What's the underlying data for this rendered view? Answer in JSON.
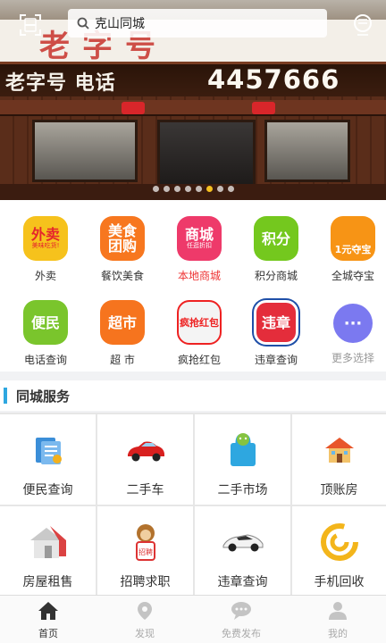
{
  "search": {
    "text": "克山同城"
  },
  "banner": {
    "sign_mark": "老字号",
    "sign_text": "老字号 电话",
    "sign_phone": "4457666",
    "slide_count": 8,
    "active_slide": 5
  },
  "quick_menu": {
    "items": [
      {
        "label": "外卖",
        "icon_text": "外卖",
        "icon_sub": "美味吃货!",
        "icon": "takeout-icon",
        "color": "#f6c21c",
        "text_color": "#e5262c"
      },
      {
        "label": "餐饮美食",
        "icon_text": "美食\n团购",
        "icon": "food-group-icon",
        "color": "#f7771f"
      },
      {
        "label": "本地商城",
        "icon_text": "商城",
        "icon_sub": "任逛折扣",
        "icon": "mall-icon",
        "color": "#ee3a6a"
      },
      {
        "label": "积分商城",
        "icon_text": "积分",
        "icon": "points-icon",
        "color": "#74c81e"
      },
      {
        "label": "全城夺宝",
        "icon_text": "1元夺宝",
        "icon": "treasure-icon",
        "color": "#f79415"
      },
      {
        "label": "电话查询",
        "icon_text": "便民",
        "icon": "phone-lookup-icon",
        "color": "#7ac52c"
      },
      {
        "label": "超  市",
        "icon_text": "超市",
        "icon": "supermarket-icon",
        "color": "#f6741e"
      },
      {
        "label": "疯抢红包",
        "icon_text": "疯抢红包",
        "icon": "red-packet-icon",
        "color": "#f4f4f4"
      },
      {
        "label": "违章查询",
        "icon_text": "违章",
        "icon": "violation-icon",
        "color": "#e42d3b"
      },
      {
        "label": "更多选择",
        "icon_text": "···",
        "icon": "more-icon",
        "color": "#7b79f0"
      }
    ]
  },
  "section": {
    "title": "同城服务"
  },
  "services": {
    "items": [
      {
        "label": "便民查询",
        "icon": "document-icon"
      },
      {
        "label": "二手车",
        "icon": "car-icon"
      },
      {
        "label": "二手市场",
        "icon": "shopping-bag-icon"
      },
      {
        "label": "顶账房",
        "icon": "house-icon"
      },
      {
        "label": "房屋租售",
        "icon": "for-sale-house-icon"
      },
      {
        "label": "招聘求职",
        "icon": "recruit-monkey-icon"
      },
      {
        "label": "违章查询",
        "icon": "sports-car-icon"
      },
      {
        "label": "手机回收",
        "icon": "recycle-icon"
      }
    ]
  },
  "nav": {
    "items": [
      {
        "label": "首页",
        "icon": "home-icon",
        "active": true
      },
      {
        "label": "发现",
        "icon": "location-icon",
        "active": false
      },
      {
        "label": "免费发布",
        "icon": "chat-icon",
        "active": false
      },
      {
        "label": "我的",
        "icon": "user-icon",
        "active": false
      }
    ]
  },
  "colors": {
    "accent": "#2ea7e0",
    "active_dot": "#f5c020",
    "highlight_label": "#e33333"
  }
}
